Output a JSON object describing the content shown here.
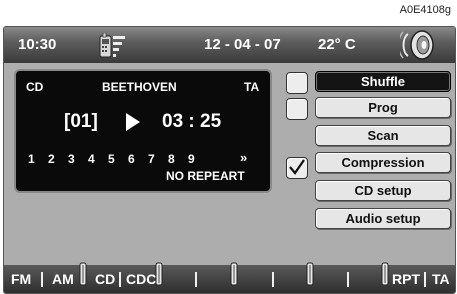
{
  "figure_code": "A0E4108g",
  "status": {
    "time": "10:30",
    "date": "12 - 04 - 07",
    "temperature": "22° C"
  },
  "cd": {
    "source": "CD",
    "album": "BEETHOVEN",
    "ta": "TA",
    "track": "[01]",
    "elapsed": "03 : 25",
    "track_numbers": [
      "1",
      "2",
      "3",
      "4",
      "5",
      "6",
      "7",
      "8",
      "9"
    ],
    "more": "»",
    "repeat_status": "NO REPEART"
  },
  "menu": [
    {
      "label": "Shuffle",
      "active": true,
      "checkbox": "unchecked"
    },
    {
      "label": "Prog",
      "active": false,
      "checkbox": "unchecked"
    },
    {
      "label": "Scan",
      "active": false,
      "checkbox": "none"
    },
    {
      "label": "Compression",
      "active": false,
      "checkbox": "checked"
    },
    {
      "label": "CD setup",
      "active": false,
      "checkbox": "none"
    },
    {
      "label": "Audio setup",
      "active": false,
      "checkbox": "none"
    }
  ],
  "bottom": {
    "fm": "FM",
    "am": "AM",
    "cd": "CD",
    "cdc": "CDC",
    "rpt": "RPT",
    "ta": "TA"
  },
  "colors": {
    "screen_bg": "#adadad",
    "bar": "#3a3a3a",
    "panel": "#0a0a0a",
    "active_button": "#141414"
  },
  "icons": [
    "phone-signal-icon",
    "speaker-icon",
    "play-icon",
    "checkmark-icon"
  ]
}
